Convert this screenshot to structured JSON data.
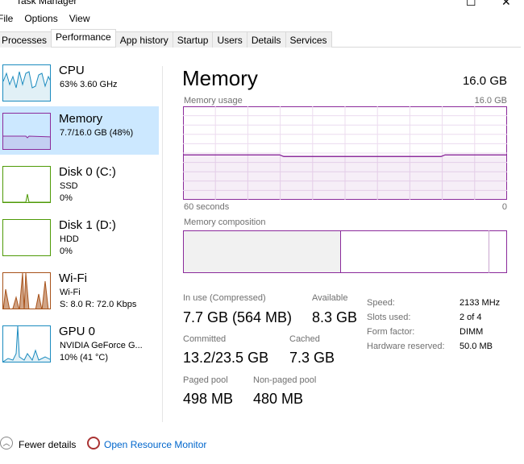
{
  "window": {
    "title": "Task Manager",
    "maximize_icon": "maximize-icon",
    "close_icon": "close-icon"
  },
  "menu": [
    "File",
    "Options",
    "View"
  ],
  "tabs": [
    {
      "label": "Processes"
    },
    {
      "label": "Performance",
      "active": true
    },
    {
      "label": "App history"
    },
    {
      "label": "Startup"
    },
    {
      "label": "Users"
    },
    {
      "label": "Details"
    },
    {
      "label": "Services"
    }
  ],
  "sidebar": [
    {
      "name": "CPU",
      "sub1": "63%  3.60 GHz",
      "color": "#1b8bbf"
    },
    {
      "name": "Memory",
      "sub1": "7.7/16.0 GB (48%)",
      "color": "#8b2a9b",
      "selected": true
    },
    {
      "name": "Disk 0 (C:)",
      "sub1": "SSD",
      "sub2": "0%",
      "color": "#4e9a06"
    },
    {
      "name": "Disk 1 (D:)",
      "sub1": "HDD",
      "sub2": "0%",
      "color": "#4e9a06"
    },
    {
      "name": "Wi-Fi",
      "sub1": "Wi-Fi",
      "sub2": "S: 8.0 R: 72.0 Kbps",
      "color": "#a7521a"
    },
    {
      "name": "GPU 0",
      "sub1": "NVIDIA GeForce G...",
      "sub2": "10% (41 °C)",
      "color": "#1b8bbf"
    }
  ],
  "main": {
    "title": "Memory",
    "total": "16.0 GB",
    "usage_label": "Memory usage",
    "usage_max": "16.0 GB",
    "usage_percent": 48,
    "time_left": "60 seconds",
    "time_right": "0",
    "composition_label": "Memory composition",
    "accent": "#8b2a9b",
    "stats": {
      "in_use_label": "In use (Compressed)",
      "in_use": "7.7 GB (564 MB)",
      "available_label": "Available",
      "available": "8.3 GB",
      "committed_label": "Committed",
      "committed": "13.2/23.5 GB",
      "cached_label": "Cached",
      "cached": "7.3 GB",
      "paged_label": "Paged pool",
      "paged": "498 MB",
      "nonpaged_label": "Non-paged pool",
      "nonpaged": "480 MB"
    },
    "props": [
      {
        "k": "Speed:",
        "v": "2133 MHz"
      },
      {
        "k": "Slots used:",
        "v": "2 of 4"
      },
      {
        "k": "Form factor:",
        "v": "DIMM"
      },
      {
        "k": "Hardware reserved:",
        "v": "50.0 MB"
      }
    ]
  },
  "footer": {
    "fewer": "Fewer details",
    "monitor": "Open Resource Monitor"
  }
}
